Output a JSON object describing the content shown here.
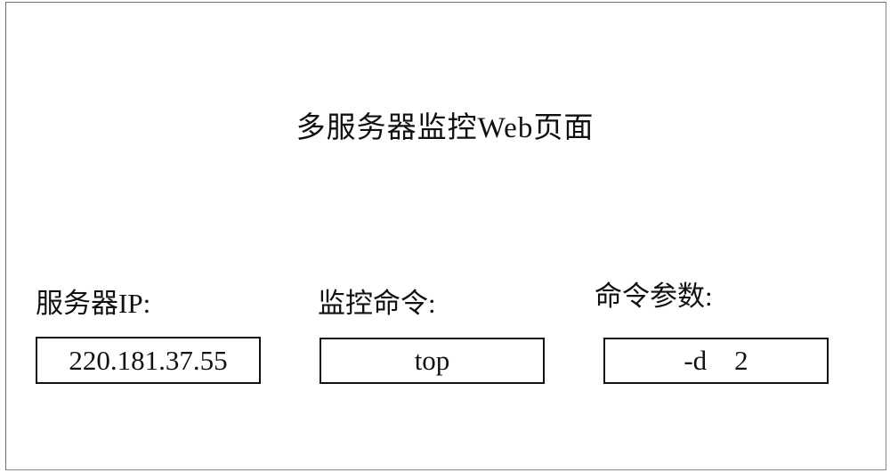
{
  "page": {
    "title": "多服务器监控Web页面"
  },
  "fields": [
    {
      "label": "服务器IP:",
      "value": "220.181.37.55"
    },
    {
      "label": "监控命令:",
      "value": "top"
    },
    {
      "label": "命令参数:",
      "value": "-d    2"
    }
  ]
}
